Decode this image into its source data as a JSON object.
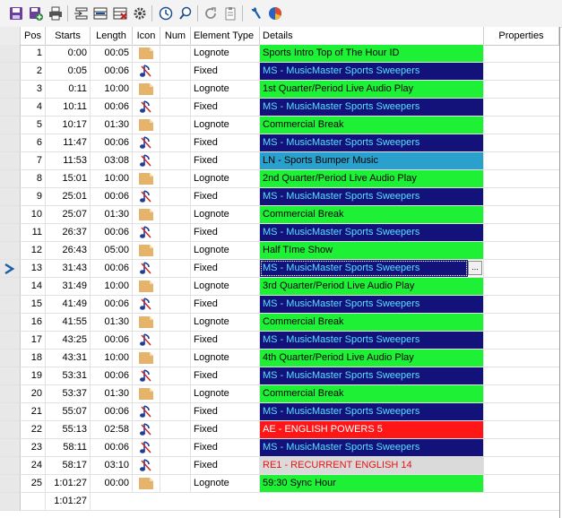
{
  "toolbar": {
    "buttons": [
      {
        "icon": "save-icon",
        "color": "#6a3fa0"
      },
      {
        "icon": "save-new-icon",
        "color": "#2a8a3a"
      },
      {
        "icon": "print-icon",
        "color": "#444444"
      },
      {
        "icon": "insert-row-icon",
        "color": "#333333"
      },
      {
        "icon": "edit-row-icon",
        "color": "#333333"
      },
      {
        "icon": "delete-row-icon",
        "color": "#c01818"
      },
      {
        "icon": "settings-icon",
        "color": "#444444"
      },
      {
        "icon": "clock-icon",
        "color": "#1d4f8a"
      },
      {
        "icon": "find-icon",
        "color": "#1d4f8a"
      },
      {
        "icon": "refresh-icon",
        "color": "#8a8a8a"
      },
      {
        "icon": "clipboard-icon",
        "color": "#8a8a8a"
      },
      {
        "icon": "tools-icon",
        "color": "#1d5fa8"
      },
      {
        "icon": "pie-chart-icon",
        "color": "#c23b2b"
      }
    ]
  },
  "columns": {
    "pos": "Pos",
    "starts": "Starts",
    "length": "Length",
    "icon": "Icon",
    "num": "Num",
    "element_type": "Element Type",
    "details": "Details",
    "properties": "Properties"
  },
  "colors": {
    "green": "#1ef036",
    "navy": "#12127a",
    "blue": "#2aa0cc",
    "red": "#ff1616",
    "gray": "#dadada",
    "navy_text": "#5ae0ff",
    "dark_text": "#000000",
    "red_text": "#e81414",
    "white_text": "#ffffff"
  },
  "rows": [
    {
      "pos": "1",
      "starts": "0:00",
      "length": "00:05",
      "icon": "document-icon",
      "type": "Lognote",
      "details": "Sports Intro Top of The Hour ID",
      "bg": "green"
    },
    {
      "pos": "2",
      "starts": "0:05",
      "length": "00:06",
      "icon": "music-note-icon",
      "type": "Fixed",
      "details": "MS - MusicMaster Sports Sweepers",
      "bg": "navy"
    },
    {
      "pos": "3",
      "starts": "0:11",
      "length": "10:00",
      "icon": "document-icon",
      "type": "Lognote",
      "details": "1st Quarter/Period Live Audio Play",
      "bg": "green"
    },
    {
      "pos": "4",
      "starts": "10:11",
      "length": "00:06",
      "icon": "music-note-icon",
      "type": "Fixed",
      "details": "MS - MusicMaster Sports Sweepers",
      "bg": "navy"
    },
    {
      "pos": "5",
      "starts": "10:17",
      "length": "01:30",
      "icon": "document-icon",
      "type": "Lognote",
      "details": "Commercial Break",
      "bg": "green"
    },
    {
      "pos": "6",
      "starts": "11:47",
      "length": "00:06",
      "icon": "music-note-icon",
      "type": "Fixed",
      "details": "MS - MusicMaster Sports Sweepers",
      "bg": "navy"
    },
    {
      "pos": "7",
      "starts": "11:53",
      "length": "03:08",
      "icon": "music-note-icon",
      "type": "Fixed",
      "details": "LN - Sports Bumper Music",
      "bg": "blue"
    },
    {
      "pos": "8",
      "starts": "15:01",
      "length": "10:00",
      "icon": "document-icon",
      "type": "Lognote",
      "details": "2nd Quarter/Period Live Audio Play",
      "bg": "green"
    },
    {
      "pos": "9",
      "starts": "25:01",
      "length": "00:06",
      "icon": "music-note-icon",
      "type": "Fixed",
      "details": "MS - MusicMaster Sports Sweepers",
      "bg": "navy"
    },
    {
      "pos": "10",
      "starts": "25:07",
      "length": "01:30",
      "icon": "document-icon",
      "type": "Lognote",
      "details": "Commercial Break",
      "bg": "green"
    },
    {
      "pos": "11",
      "starts": "26:37",
      "length": "00:06",
      "icon": "music-note-icon",
      "type": "Fixed",
      "details": "MS - MusicMaster Sports Sweepers",
      "bg": "navy"
    },
    {
      "pos": "12",
      "starts": "26:43",
      "length": "05:00",
      "icon": "document-icon",
      "type": "Lognote",
      "details": "Half TIme Show",
      "bg": "green"
    },
    {
      "pos": "13",
      "starts": "31:43",
      "length": "00:06",
      "icon": "music-note-icon",
      "type": "Fixed",
      "details": "MS - MusicMaster Sports Sweepers",
      "bg": "navy",
      "current": true
    },
    {
      "pos": "14",
      "starts": "31:49",
      "length": "10:00",
      "icon": "document-icon",
      "type": "Lognote",
      "details": "3rd Quarter/Period Live Audio Play",
      "bg": "green"
    },
    {
      "pos": "15",
      "starts": "41:49",
      "length": "00:06",
      "icon": "music-note-icon",
      "type": "Fixed",
      "details": "MS - MusicMaster Sports Sweepers",
      "bg": "navy"
    },
    {
      "pos": "16",
      "starts": "41:55",
      "length": "01:30",
      "icon": "document-icon",
      "type": "Lognote",
      "details": "Commercial Break",
      "bg": "green"
    },
    {
      "pos": "17",
      "starts": "43:25",
      "length": "00:06",
      "icon": "music-note-icon",
      "type": "Fixed",
      "details": "MS - MusicMaster Sports Sweepers",
      "bg": "navy"
    },
    {
      "pos": "18",
      "starts": "43:31",
      "length": "10:00",
      "icon": "document-icon",
      "type": "Lognote",
      "details": "4th Quarter/Period Live Audio Play",
      "bg": "green"
    },
    {
      "pos": "19",
      "starts": "53:31",
      "length": "00:06",
      "icon": "music-note-icon",
      "type": "Fixed",
      "details": "MS - MusicMaster Sports Sweepers",
      "bg": "navy"
    },
    {
      "pos": "20",
      "starts": "53:37",
      "length": "01:30",
      "icon": "document-icon",
      "type": "Lognote",
      "details": "Commercial Break",
      "bg": "green"
    },
    {
      "pos": "21",
      "starts": "55:07",
      "length": "00:06",
      "icon": "music-note-icon",
      "type": "Fixed",
      "details": "MS - MusicMaster Sports Sweepers",
      "bg": "navy"
    },
    {
      "pos": "22",
      "starts": "55:13",
      "length": "02:58",
      "icon": "music-note-icon",
      "type": "Fixed",
      "details": "AE - ENGLISH POWERS 5",
      "bg": "red"
    },
    {
      "pos": "23",
      "starts": "58:11",
      "length": "00:06",
      "icon": "music-note-icon",
      "type": "Fixed",
      "details": "MS - MusicMaster Sports Sweepers",
      "bg": "navy"
    },
    {
      "pos": "24",
      "starts": "58:17",
      "length": "03:10",
      "icon": "music-note-icon",
      "type": "Fixed",
      "details": "RE1 - RECURRENT ENGLISH 14",
      "bg": "gray"
    },
    {
      "pos": "25",
      "starts": "1:01:27",
      "length": "00:00",
      "icon": "document-icon",
      "type": "Lognote",
      "details": "59:30 Sync Hour",
      "bg": "green"
    }
  ],
  "footer": {
    "starts": "1:01:27"
  },
  "editor": {
    "button_label": "..."
  }
}
